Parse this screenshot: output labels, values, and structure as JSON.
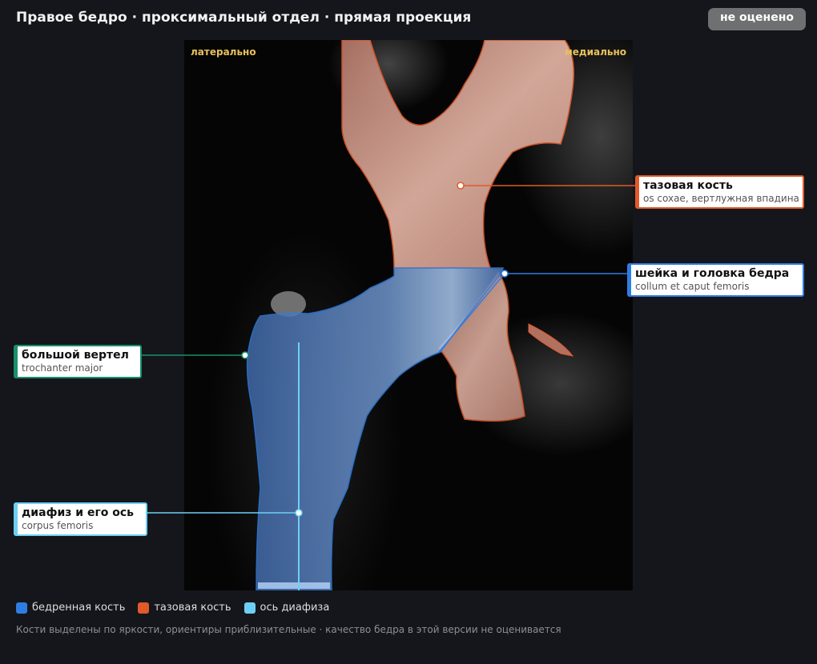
{
  "header": {
    "title": "Правое бедро · проксимальный отдел · прямая проекция",
    "status_badge": "не оценено"
  },
  "viewer": {
    "orientation_left": "латерально",
    "orientation_right": "медиально"
  },
  "callouts": {
    "pelvis": {
      "title": "тазовая кость",
      "subtitle": "os coxae, вертлужная впадина"
    },
    "neck_head": {
      "title": "шейка и головка бедра",
      "subtitle": "collum et caput femoris"
    },
    "trochanter": {
      "title": "большой вертел",
      "subtitle": "trochanter major"
    },
    "shaft": {
      "title": "диафиз и его ось",
      "subtitle": "corpus femoris"
    }
  },
  "legend": [
    {
      "label": "бедренная кость",
      "color": "#2f7de1"
    },
    {
      "label": "тазовая кость",
      "color": "#e05a2a"
    },
    {
      "label": "ось диафиза",
      "color": "#6ecff6"
    }
  ],
  "colors": {
    "femur": "#2f7de1",
    "pelvis": "#e05a2a",
    "shaft_axis": "#6ecff6",
    "trochanter": "#1a8f6a"
  },
  "footer": {
    "note": "Кости выделены по яркости, ориентиры приблизительные · качество бедра в этой версии не оценивается"
  }
}
